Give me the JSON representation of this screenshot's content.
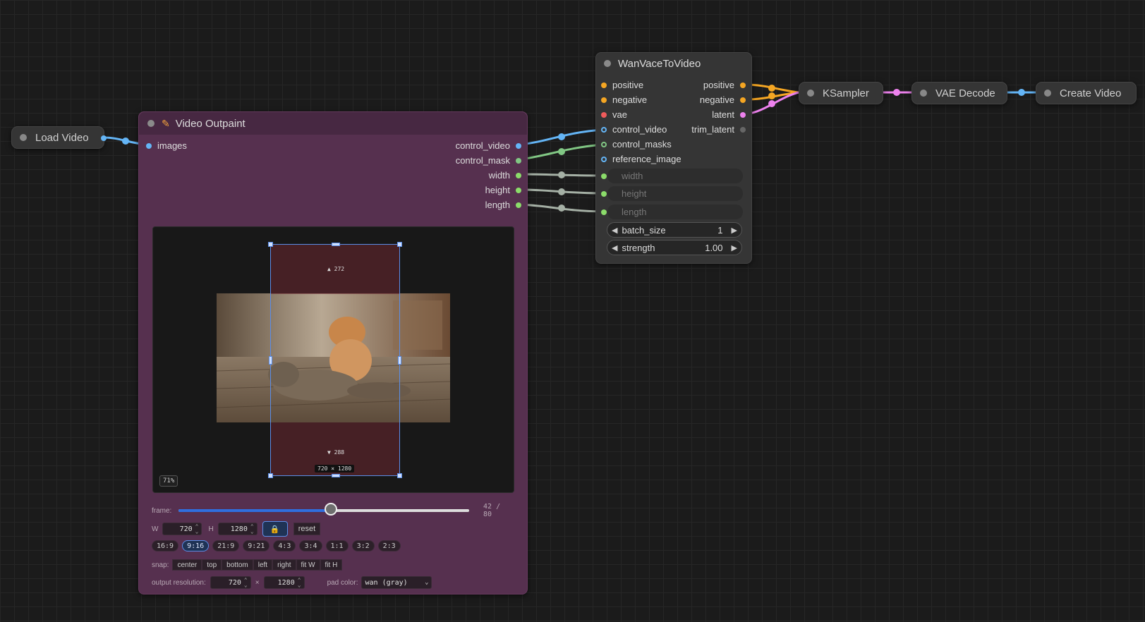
{
  "nodes": {
    "load_video": {
      "title": "Load Video"
    },
    "video_outpaint": {
      "title": "Video Outpaint",
      "inputs": [
        "images"
      ],
      "outputs": [
        "control_video",
        "control_mask",
        "width",
        "height",
        "length"
      ],
      "preview": {
        "pad_top": "▲ 272",
        "pad_bottom": "▼ 288",
        "size_label": "720 × 1280",
        "zoom": "71%"
      },
      "frame": {
        "label": "frame:",
        "current": 42,
        "total": 80,
        "readout": "42 / 80"
      },
      "dims": {
        "w_label": "W",
        "w_value": "720",
        "h_label": "H",
        "h_value": "1280",
        "lock_icon": "🔒",
        "reset_label": "reset"
      },
      "aspects": [
        "16:9",
        "9:16",
        "21:9",
        "9:21",
        "4:3",
        "3:4",
        "1:1",
        "3:2",
        "2:3"
      ],
      "aspect_active": "9:16",
      "snap": {
        "label": "snap:",
        "options": [
          "center",
          "top",
          "bottom",
          "left",
          "right",
          "fit W",
          "fit H"
        ]
      },
      "output": {
        "label": "output resolution:",
        "w": "720",
        "times": "×",
        "h": "1280",
        "pad_label": "pad color:",
        "pad_value": "wan (gray)"
      }
    },
    "wan": {
      "title": "WanVaceToVideo",
      "inputs": [
        "positive",
        "negative",
        "vae",
        "control_video",
        "control_masks",
        "reference_image"
      ],
      "outputs": [
        "positive",
        "negative",
        "latent",
        "trim_latent"
      ],
      "widget_inputs": [
        "width",
        "height",
        "length"
      ],
      "widgets": [
        {
          "name": "batch_size",
          "value": "1"
        },
        {
          "name": "strength",
          "value": "1.00"
        }
      ]
    },
    "ksampler": {
      "title": "KSampler"
    },
    "vae_decode": {
      "title": "VAE Decode"
    },
    "create_video": {
      "title": "Create Video"
    }
  },
  "colors": {
    "conditioning": "#f5a623",
    "vae": "#ef5b5b",
    "image": "#64b5f6",
    "mask": "#81c784",
    "int": "#a5b0a5",
    "latent": "#ee82ee",
    "accent": "#5b8ee8"
  }
}
